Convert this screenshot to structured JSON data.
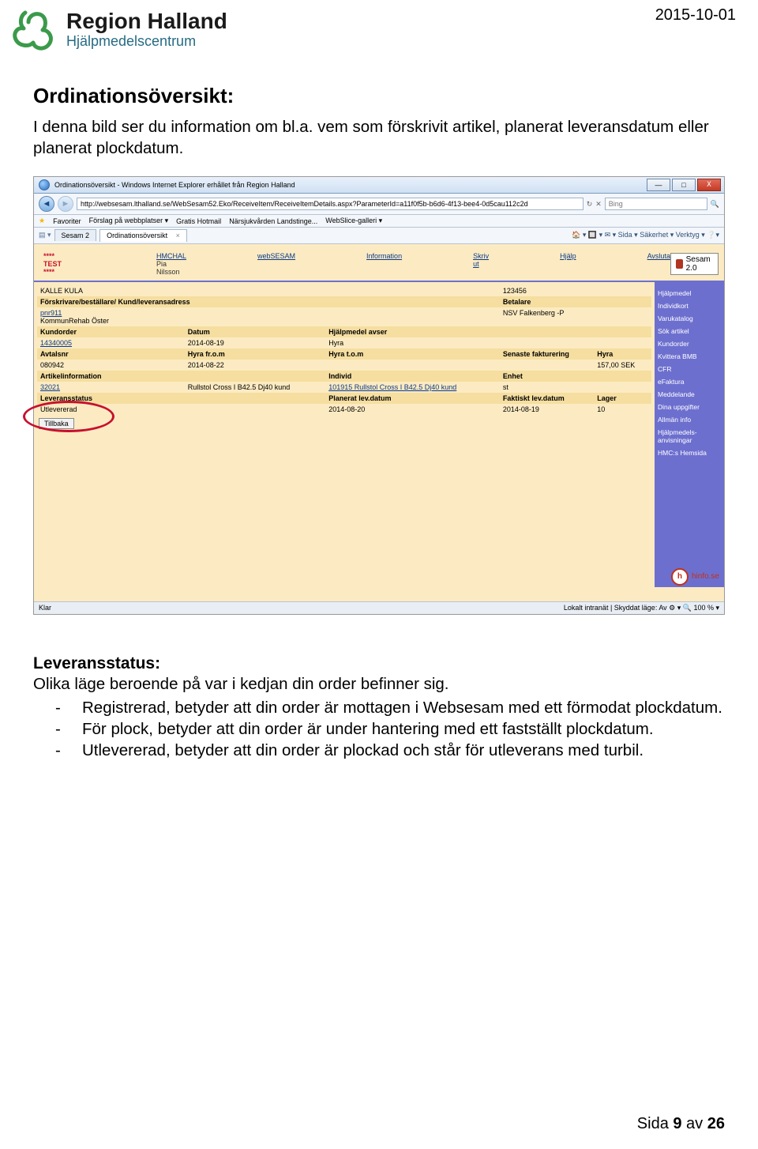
{
  "page_date": "2015-10-01",
  "logo": {
    "line1": "Region Halland",
    "line2": "Hjälpmedelscentrum"
  },
  "h1": "Ordinationsöversikt:",
  "intro": "I denna bild ser du information om bl.a. vem som förskrivit artikel, planerat leveransdatum eller planerat plockdatum.",
  "shot": {
    "titlebar": "Ordinationsöversikt - Windows Internet Explorer erhållet från Region Halland",
    "url": "http://websesam.lthalland.se/WebSesam52.Eko/ReceiveItem/ReceiveItemDetails.aspx?ParameterId=a11f0f5b-b6d6-4f13-bee4-0d5cau112c2d",
    "search_engine": "Bing",
    "win_min": "—",
    "win_max": "□",
    "win_close": "X",
    "fav_label": "Favoriter",
    "fav_items": [
      "Förslag på webbplatser ▾",
      "Gratis Hotmail",
      "Närsjukvården Landstinge...",
      "WebSlice-galleri ▾"
    ],
    "tab1": "Sesam 2",
    "tab2": "Ordinationsöversikt",
    "tab_tools": "🏠 ▾  🔲 ▾  ✉ ▾  Sida ▾  Säkerhet ▾  Verktyg ▾  ❔▾",
    "test": "**** TEST ****",
    "top": [
      {
        "t": "HMCHAL",
        "sub": "Pia Nilsson"
      },
      {
        "t": "webSESAM",
        "sub": ""
      },
      {
        "t": "Information",
        "sub": ""
      },
      {
        "t": "Skriv ut",
        "sub": ""
      },
      {
        "t": "Hjälp",
        "sub": ""
      },
      {
        "t": "Avsluta",
        "sub": ""
      }
    ],
    "sesam_badge": "Sesam 2.0",
    "patient_name": "KALLE KULA",
    "patient_id": "123456",
    "row_forskrivare": "Förskrivare/beställare/ Kund/leveransadress",
    "row_betalare": "Betalare",
    "pnr": "pnr911",
    "kund": "KommunRehab Öster",
    "betalare_val": "NSV Falkenberg -P",
    "h_kundorder": "Kundorder",
    "h_datum": "Datum",
    "h_avser": "Hjälpmedel avser",
    "v_kundorder": "14340005",
    "v_datum": "2014-08-19",
    "v_avser": "Hyra",
    "h_avtalsnr": "Avtalsnr",
    "h_hyrafrom": "Hyra fr.o.m",
    "h_hyratom": "Hyra t.o.m",
    "h_senfakt": "Senaste fakturering",
    "h_hyra": "Hyra",
    "v_avtalsnr": "080942",
    "v_hyrafrom": "2014-08-22",
    "v_hyra": "157,00 SEK",
    "h_artinfo": "Artikelinformation",
    "h_individ": "Individ",
    "h_enhet": "Enhet",
    "v_artinfo": "32021",
    "v_artname": "Rullstol Cross I B42.5 Dj40 kund",
    "v_individ": "101915 Rullstol Cross I B42.5 Dj40 kund",
    "v_enhet": "st",
    "h_levstatus": "Leveransstatus",
    "h_planlev": "Planerat lev.datum",
    "h_faktlev": "Faktiskt lev.datum",
    "h_lager": "Lager",
    "v_levstatus": "Utlevererad",
    "v_planlev": "2014-08-20",
    "v_faktlev": "2014-08-19",
    "v_lager": "10",
    "tillbaka": "Tillbaka",
    "sidebar": [
      "Hjälpmedel",
      "Individkort",
      "Varukatalog",
      "Sök artikel",
      "Kundorder",
      "Kvittera BMB",
      "CFR",
      "eFaktura",
      "Meddelande",
      "Dina uppgifter",
      "Allmän info",
      "Hjälpmedels-\nanvisningar",
      "HMC:s Hemsida"
    ],
    "hinfo": "hinfo.se",
    "status_left": "Klar",
    "status_right": "Lokalt intranät | Skyddat läge: Av      ⚙ ▾   🔍 100 % ▾"
  },
  "h2": "Leveransstatus:",
  "subline": "Olika läge beroende på var i kedjan din order befinner sig.",
  "bullets": [
    "Registrerad, betyder att din order är mottagen i Websesam med ett förmodat plockdatum.",
    "För plock, betyder att din order är under hantering med ett fastställt plockdatum.",
    "Utlevererad, betyder att din order är plockad och står för utleverans med turbil."
  ],
  "footer_prefix": "Sida ",
  "footer_page": "9",
  "footer_mid": " av ",
  "footer_total": "26"
}
